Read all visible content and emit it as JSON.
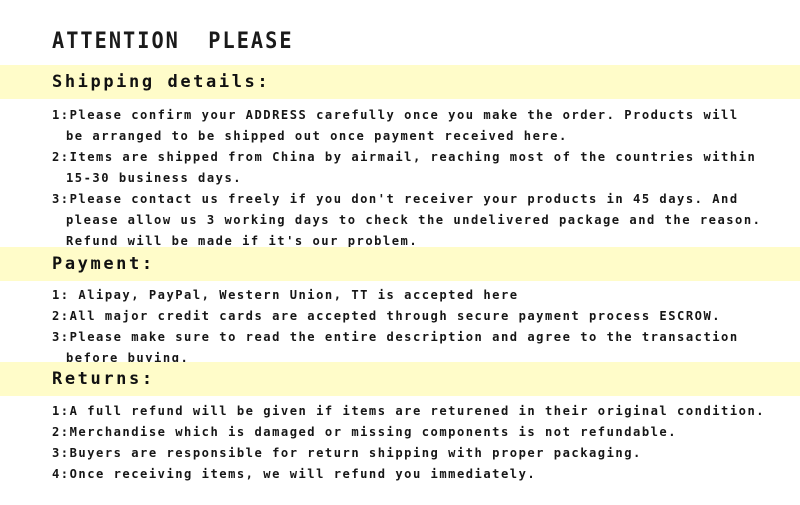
{
  "page": {
    "title": "ATTENTION  PLEASE",
    "background_color": "#ffffff",
    "band_color": "#fffcc9",
    "text_color": "#161616"
  },
  "sections": [
    {
      "heading": "Shipping details:",
      "lines": [
        {
          "text": "1:Please confirm your ADDRESS carefully once you make the order. Products will",
          "indent": false
        },
        {
          "text": "be arranged to be shipped out once payment received here.",
          "indent": true
        },
        {
          "text": "2:Items are shipped from China by airmail, reaching most of the countries within",
          "indent": false
        },
        {
          "text": "15-30 business days.",
          "indent": true
        },
        {
          "text": "3:Please contact us freely if you don't receiver your products in 45 days. And",
          "indent": false
        },
        {
          "text": "please allow us 3 working days to check the undelivered package and the reason.",
          "indent": true
        },
        {
          "text": "Refund will be made if it's our problem.",
          "indent": true
        }
      ]
    },
    {
      "heading": "Payment:",
      "lines": [
        {
          "text": "1: Alipay, PayPal, Western Union, TT is accepted here",
          "indent": false
        },
        {
          "text": "2:All major credit cards are accepted through secure payment process ESCROW.",
          "indent": false
        },
        {
          "text": "3:Please make sure to read the entire description and agree to the transaction",
          "indent": false
        },
        {
          "text": "before buying.",
          "indent": true
        }
      ]
    },
    {
      "heading": "Returns:",
      "lines": [
        {
          "text": "1:A full refund will be given if items are returened in their original condition.",
          "indent": false
        },
        {
          "text": "2:Merchandise which is damaged or missing components is not refundable.",
          "indent": false
        },
        {
          "text": "3:Buyers are responsible for return shipping with proper packaging.",
          "indent": false
        },
        {
          "text": "4:Once receiving items, we will refund you immediately.",
          "indent": false
        }
      ]
    }
  ],
  "layout": {
    "band_tops": [
      65,
      247,
      362
    ],
    "body_tops": [
      107,
      287,
      403
    ],
    "line_height": 21
  }
}
